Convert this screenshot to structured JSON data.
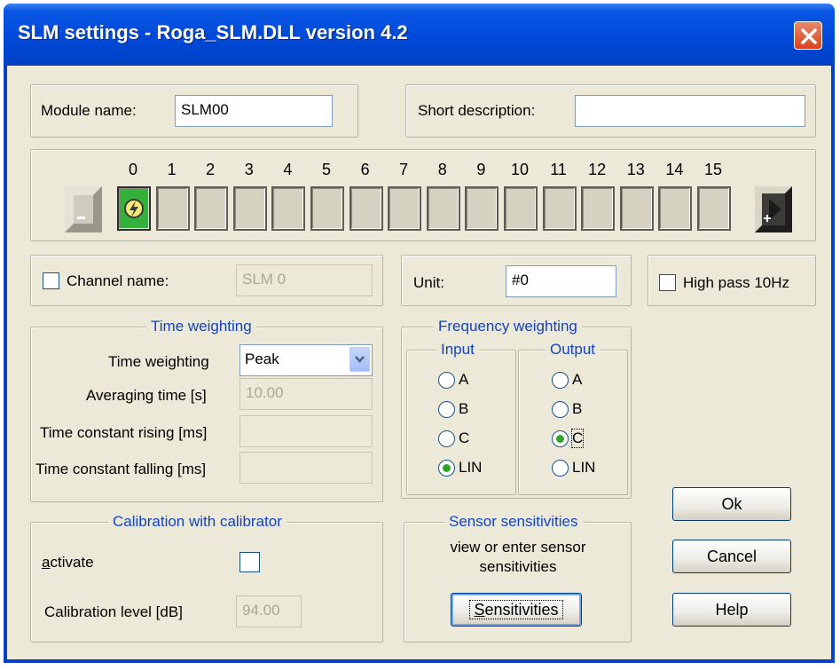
{
  "window": {
    "title": "SLM settings - Roga_SLM.DLL version 4.2"
  },
  "module": {
    "label": "Module name:",
    "value": "SLM00"
  },
  "short_description": {
    "label": "Short description:",
    "value": ""
  },
  "channels": {
    "numbers": [
      "0",
      "1",
      "2",
      "3",
      "4",
      "5",
      "6",
      "7",
      "8",
      "9",
      "10",
      "11",
      "12",
      "13",
      "14",
      "15"
    ],
    "active_index": 0,
    "prev_symbol": "-",
    "next_symbol": "+"
  },
  "channel_name": {
    "label": "Channel name:",
    "value": "SLM 0",
    "checked": false
  },
  "unit": {
    "label": "Unit:",
    "value": "#0"
  },
  "high_pass": {
    "label": "High pass 10Hz",
    "checked": false
  },
  "time_weighting": {
    "legend": "Time weighting",
    "select_label": "Time weighting",
    "select_value": "Peak",
    "averaging_label": "Averaging time [s]",
    "averaging_value": "10.00",
    "rising_label": "Time constant rising [ms]",
    "rising_value": "",
    "falling_label": "Time constant falling [ms]",
    "falling_value": ""
  },
  "frequency_weighting": {
    "legend": "Frequency weighting",
    "input": {
      "legend": "Input",
      "options": [
        "A",
        "B",
        "C",
        "LIN"
      ],
      "selected": "LIN"
    },
    "output": {
      "legend": "Output",
      "options": [
        "A",
        "B",
        "C",
        "LIN"
      ],
      "selected": "C"
    }
  },
  "calibration": {
    "legend": "Calibration with calibrator",
    "activate_label": "activate",
    "activate_checked": false,
    "level_label": "Calibration level [dB]",
    "level_value": "94.00"
  },
  "sensor": {
    "legend": "Sensor sensitivities",
    "description": "view or enter sensor sensitivities",
    "button_label": "Sensitivities"
  },
  "buttons": {
    "ok": "Ok",
    "cancel": "Cancel",
    "help": "Help"
  },
  "colors": {
    "title_blue": "#0049d8",
    "dialog_bg": "#ece9d8",
    "legend_blue": "#1543c2",
    "active_channel": "#33b13a"
  }
}
